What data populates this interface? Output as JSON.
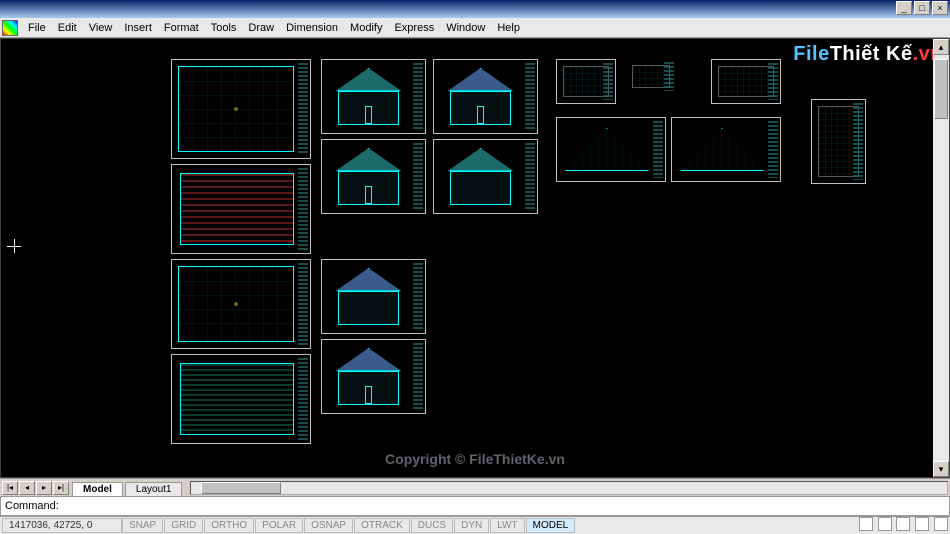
{
  "window": {
    "min": "_",
    "max": "□",
    "close": "×"
  },
  "menu": {
    "items": [
      "File",
      "Edit",
      "View",
      "Insert",
      "Format",
      "Tools",
      "Draw",
      "Dimension",
      "Modify",
      "Express",
      "Window",
      "Help"
    ]
  },
  "watermark": {
    "logo_a": "File",
    "logo_b": "Thiết Kế",
    "logo_c": ".vn",
    "text": "Copyright © FileThietKe.vn"
  },
  "tabs": {
    "first": "|◂",
    "prev": "◂",
    "next": "▸",
    "last": "▸|",
    "model": "Model",
    "layout1": "Layout1"
  },
  "command": {
    "prompt": "Command:",
    "value": ""
  },
  "status": {
    "coords": "1417036, 42725, 0",
    "toggles": [
      "SNAP",
      "GRID",
      "ORTHO",
      "POLAR",
      "OSNAP",
      "OTRACK",
      "DUCS",
      "DYN",
      "LWT",
      "MODEL"
    ]
  }
}
